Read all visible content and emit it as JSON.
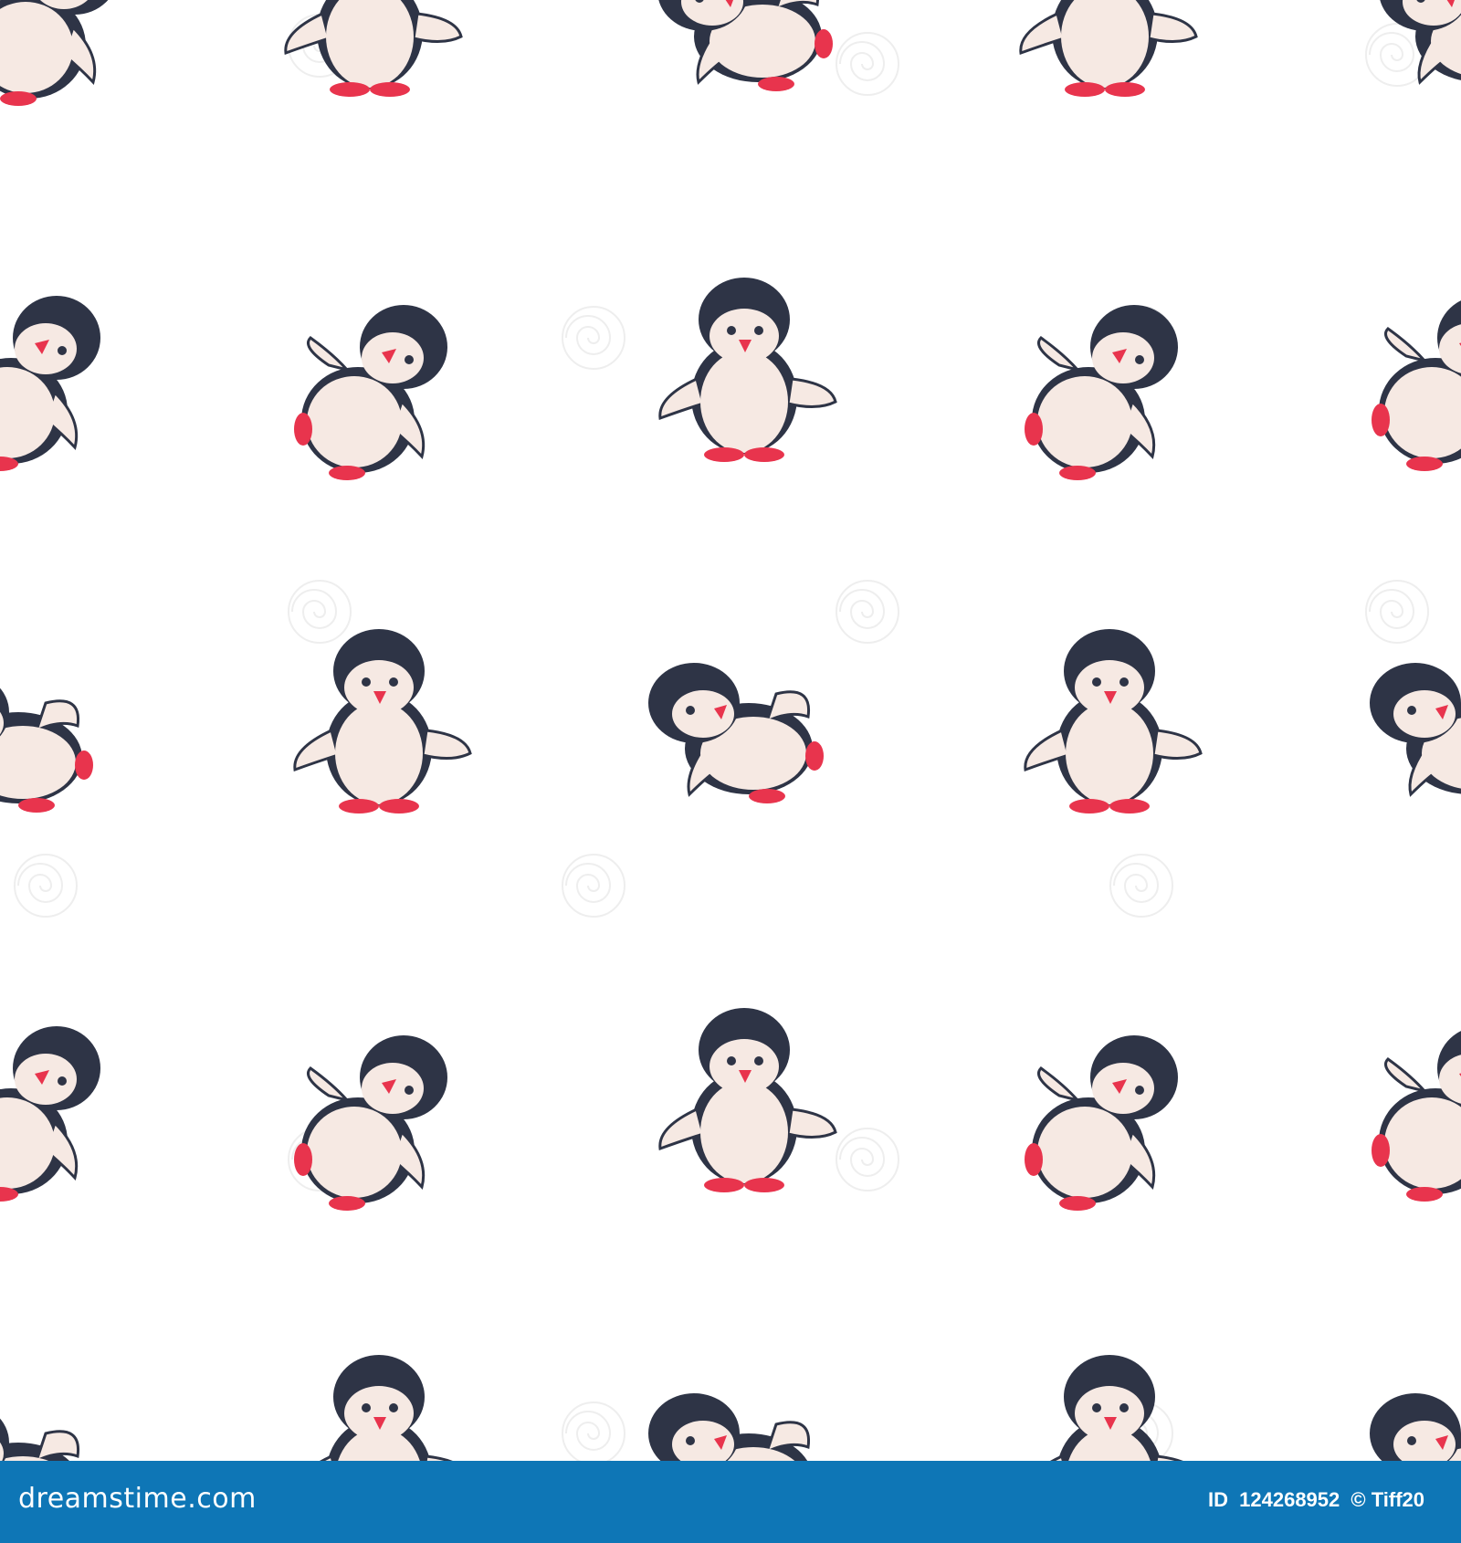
{
  "image": {
    "background_color": "#ffffff",
    "pattern": {
      "subject": "cartoon baby penguin",
      "colors": {
        "body": "#2e3446",
        "belly": "#f6e9e3",
        "feet": "#e8344d",
        "beak": "#e8344d"
      },
      "poses": [
        "facing-front",
        "tilted-right",
        "leaning-left"
      ]
    },
    "watermark_icon": "swirl-watermark-icon"
  },
  "footer": {
    "background_color": "#0e76b6",
    "brand": "dreamstime.com",
    "id_label": "ID",
    "id_value": "124268952",
    "author": "© Tiff20"
  }
}
